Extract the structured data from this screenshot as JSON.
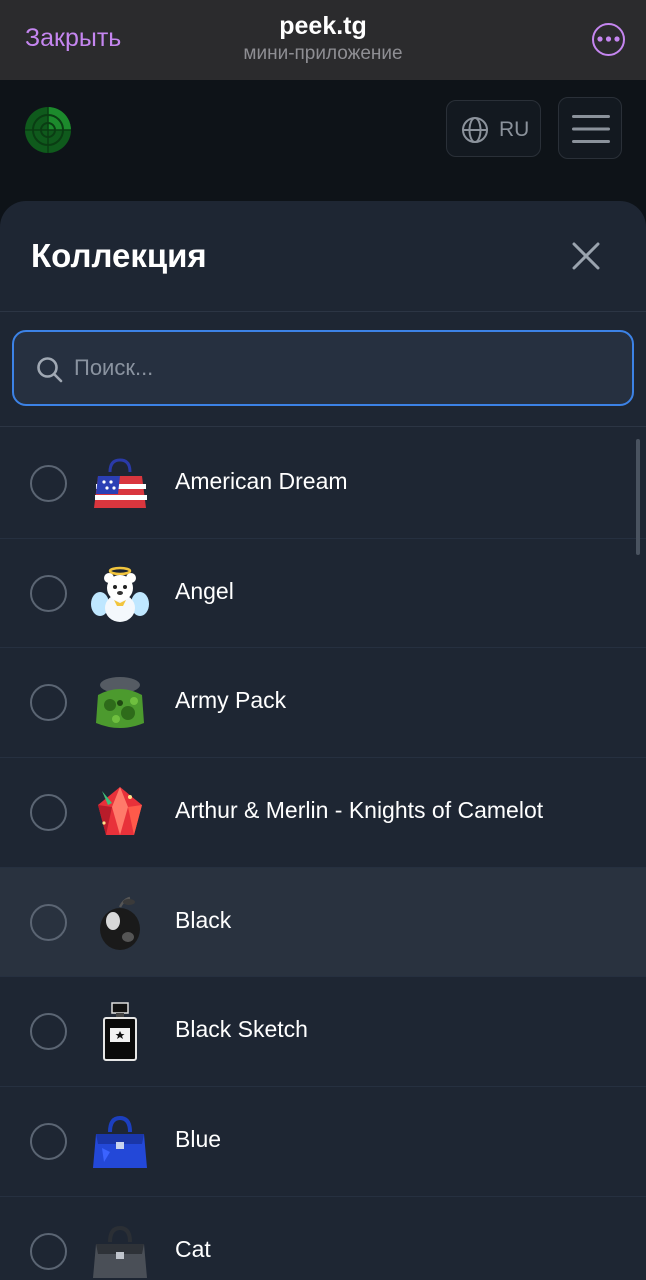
{
  "telegram_bar": {
    "close_label": "Закрыть",
    "title": "peek.tg",
    "subtitle": "мини-приложение",
    "more_icon": "ellipsis-circle-icon"
  },
  "header": {
    "logo_icon": "radar-logo-icon",
    "language_label": "RU",
    "language_icon": "globe-icon",
    "menu_icon": "hamburger-menu-icon"
  },
  "sheet": {
    "title": "Коллекция",
    "close_icon": "close-icon",
    "search": {
      "placeholder": "Поиск...",
      "value": ""
    },
    "items": [
      {
        "label": "American Dream",
        "icon": "striped-handbag-icon",
        "checked": false
      },
      {
        "label": "Angel",
        "icon": "angel-teddy-bear-icon",
        "checked": false
      },
      {
        "label": "Army Pack",
        "icon": "camo-backpack-icon",
        "checked": false
      },
      {
        "label": "Arthur & Merlin - Knights of Camelot",
        "icon": "red-crystal-icon",
        "checked": false
      },
      {
        "label": "Black",
        "icon": "black-apple-icon",
        "checked": false
      },
      {
        "label": "Black Sketch",
        "icon": "perfume-bottle-icon",
        "checked": false
      },
      {
        "label": "Blue",
        "icon": "blue-handbag-icon",
        "checked": false
      },
      {
        "label": "Cat",
        "icon": "gray-handbag-icon",
        "checked": false
      }
    ]
  },
  "colors": {
    "accent_purple": "#c586f0",
    "search_focus_blue": "#3c82e6",
    "sheet_background": "#1e2633",
    "hover_row": "#29323f"
  }
}
